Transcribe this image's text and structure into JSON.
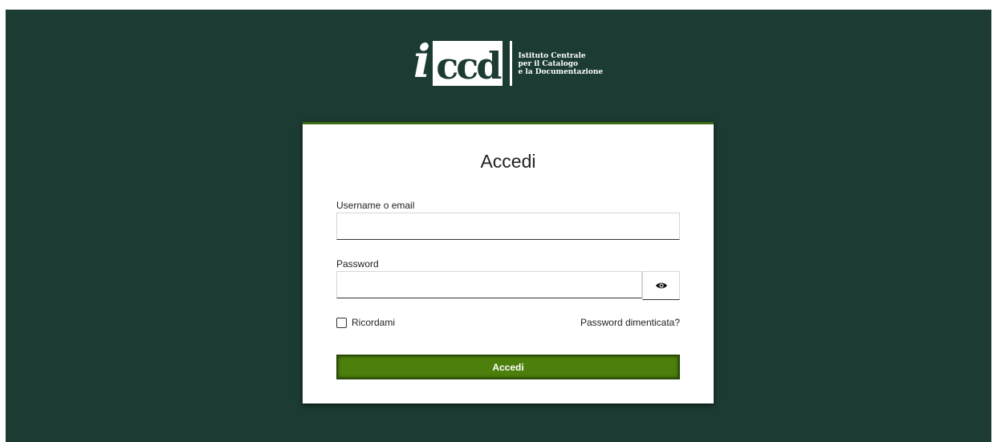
{
  "logo": {
    "letter_i": "i",
    "letters_ccd": "ccd",
    "org_lines": [
      "Istituto Centrale",
      "per il Catalogo",
      "e la Documentazione"
    ]
  },
  "login": {
    "title": "Accedi",
    "username_label": "Username o email",
    "username_value": "",
    "password_label": "Password",
    "password_value": "",
    "show_password_icon": "eye-icon",
    "remember_label": "Ricordami",
    "remember_checked": false,
    "forgot_link": "Password dimenticata?",
    "submit_label": "Accedi"
  },
  "colors": {
    "background": "#1b3b33",
    "accent": "#4c7f0c",
    "card": "#ffffff"
  }
}
